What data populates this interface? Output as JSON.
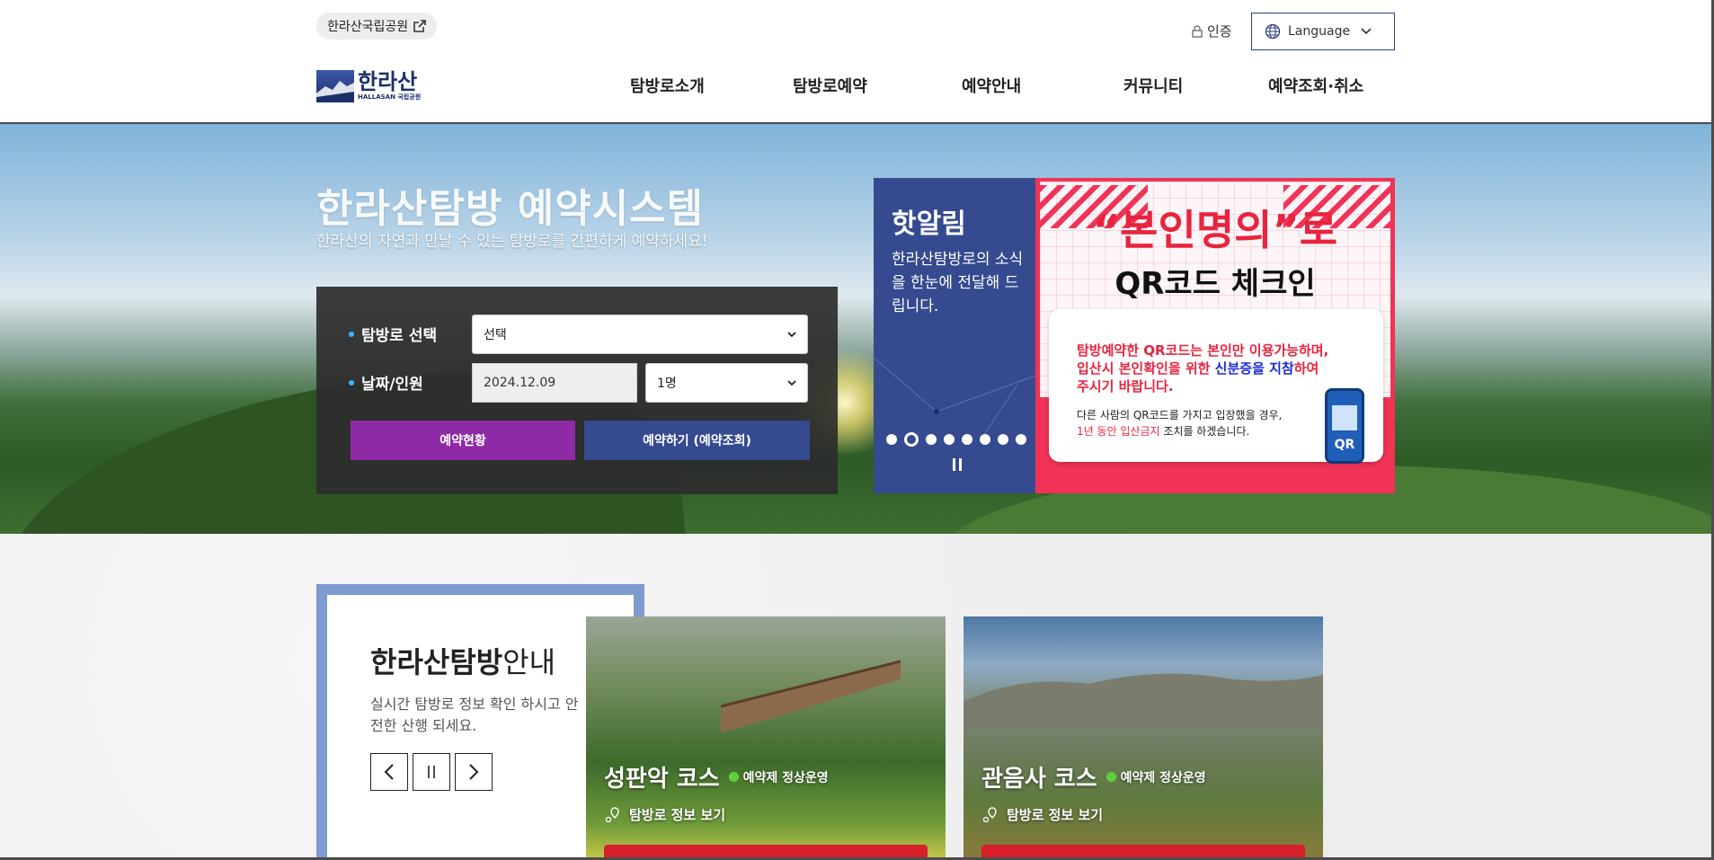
{
  "top": {
    "park_link": "한라산국립공원",
    "cert": "인증",
    "language": "Language"
  },
  "logo": {
    "text": "한라산",
    "sub": "HALLASAN 국립공원"
  },
  "nav": [
    {
      "label": "탐방로소개"
    },
    {
      "label": "탐방로예약"
    },
    {
      "label": "예약안내"
    },
    {
      "label": "커뮤니티"
    },
    {
      "label": "예약조회·취소"
    }
  ],
  "hero": {
    "title": "한라산탐방 예약시스템",
    "subtitle": "한라산의 자연과 만날 수 있는 탐방로를 간편하게 예약하세요!"
  },
  "reservation": {
    "trail_label": "탐방로 선택",
    "trail_value": "선택",
    "date_label": "날짜/인원",
    "date_value": "2024.12.09",
    "people_value": "1명",
    "status_button": "예약현황",
    "reserve_button": "예약하기 (예약조회)",
    "colors": {
      "status": "#8e2aa6",
      "reserve": "#354a8f"
    }
  },
  "notice": {
    "title": "핫알림",
    "desc": "한라산탐방로의 소식을 한눈에 전달해 드립니다."
  },
  "banner": {
    "headline": "“본인명의”로",
    "subheadline": "QR코드 체크인",
    "p1_a": "탐방예약한 QR코드는 본인만 이용가능하며,",
    "p1_b": "입산시 본인확인을 위한 ",
    "p1_c": "신분증을 지참",
    "p1_d": "하여",
    "p1_e": "주시기 바랍니다.",
    "p2_a": "다른 사람의 QR코드를 가지고 입장했을 경우,",
    "p2_b": "1년 동안 입산금지",
    "p2_c": " 조치를 하겠습니다.",
    "qr_label": "QR"
  },
  "info": {
    "title_bold": "한라산탐방",
    "title_rest": "안내",
    "desc": "실시간 탐방로 정보 확인 하시고 안전한 산행 되세요."
  },
  "courses": [
    {
      "name": "성판악 코스",
      "status": "예약제 정상운영",
      "link": "탐방로 정보 보기"
    },
    {
      "name": "관음사 코스",
      "status": "예약제 정상운영",
      "link": "탐방로 정보 보기"
    }
  ]
}
